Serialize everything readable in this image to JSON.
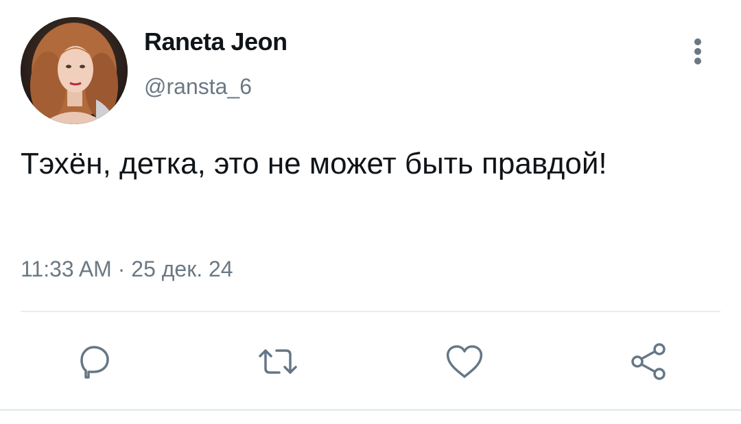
{
  "author": {
    "display_name": "Raneta Jeon",
    "handle": "@ransta_6"
  },
  "tweet": {
    "text": "Тэхён, детка, это не может быть правдой!",
    "timestamp": "11:33 AM · 25 дек. 24"
  },
  "icons": {
    "more": "more-vertical-icon",
    "reply": "reply-icon",
    "retweet": "retweet-icon",
    "like": "heart-icon",
    "share": "share-icon"
  },
  "colors": {
    "text_primary": "#0f1419",
    "text_secondary": "#6b7883",
    "divider": "#e6ecf0",
    "icon": "#657786"
  }
}
